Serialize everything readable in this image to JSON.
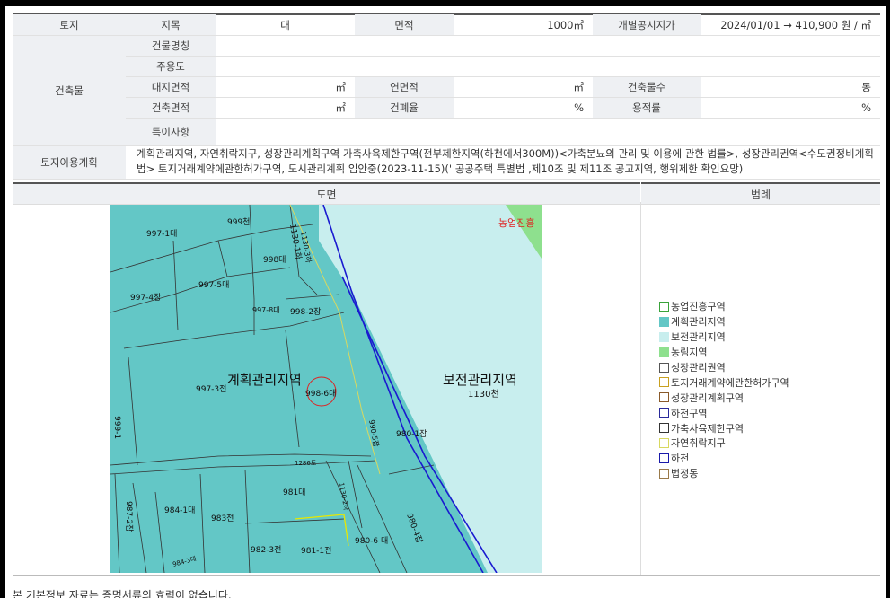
{
  "land": {
    "row_header": "토지",
    "jimok_label": "지목",
    "jimok_value": "대",
    "area_label": "면적",
    "area_value": "1000㎡",
    "price_label": "개별공시지가",
    "price_value": "2024/01/01 → 410,900 원 / ㎡"
  },
  "building": {
    "row_header": "건축물",
    "name_label": "건물명칭",
    "use_label": "주용도",
    "site_area_label": "대지면적",
    "site_area_unit": "㎡",
    "total_floor_label": "연면적",
    "total_floor_unit": "㎡",
    "count_label": "건축물수",
    "count_unit": "동",
    "building_area_label": "건축면적",
    "building_area_unit": "㎡",
    "coverage_label": "건폐율",
    "coverage_unit": "%",
    "far_label": "용적률",
    "far_unit": "%",
    "special_label": "특이사항"
  },
  "land_use": {
    "row_header": "토지이용계획",
    "text": "계획관리지역, 자연취락지구, 성장관리계획구역 가축사육제한구역(전부제한지역(하천에서300M))<가축분뇨의 관리 및 이용에 관한 법률>, 성장관리권역<수도권정비계획법> 토지거래계약에관한허가구역, 도시관리계획 입안중(2023-11-15)(' 공공주택 특별법 ,제10조 및 제11조 공고지역, 행위제한 확인요망)"
  },
  "sections": {
    "map_title": "도면",
    "legend_title": "범례"
  },
  "map_labels": {
    "zone_plan": "계획관리지역",
    "zone_conserve": "보전관리지역",
    "zone_conserve_num": "1130천",
    "zone_agri": "농업진흥",
    "parcels": [
      "999천",
      "997-1대",
      "1130-1하",
      "998대",
      "997-5대",
      "997-4장",
      "997-8대",
      "998-2장",
      "997-3전",
      "998-6대",
      "980-1잡",
      "1130천",
      "1286도",
      "981대",
      "984-1대",
      "983전",
      "987-2잡",
      "982-3전",
      "981-1전",
      "980-6 대",
      "980-4잡",
      "984-3대",
      "999-1",
      "1130-3하",
      "990-5잡",
      "1130-2하"
    ]
  },
  "legend": [
    {
      "label": "농업진흥구역",
      "fill": "#ffffff",
      "border": "#3aa33a"
    },
    {
      "label": "계획관리지역",
      "fill": "#63c7c6",
      "border": "#63c7c6"
    },
    {
      "label": "보전관리지역",
      "fill": "#c8eeee",
      "border": "#c8eeee"
    },
    {
      "label": "농림지역",
      "fill": "#8ee08e",
      "border": "#8ee08e"
    },
    {
      "label": "성장관리권역",
      "fill": "#ffffff",
      "border": "#555555"
    },
    {
      "label": "토지거래계약에관한허가구역",
      "fill": "#ffffff",
      "border": "#c8a020"
    },
    {
      "label": "성장관리계획구역",
      "fill": "#ffffff",
      "border": "#8a5a2a"
    },
    {
      "label": "하천구역",
      "fill": "#ffffff",
      "border": "#2a2a9a"
    },
    {
      "label": "가축사육제한구역",
      "fill": "#ffffff",
      "border": "#333333"
    },
    {
      "label": "자연취락지구",
      "fill": "#ffffff",
      "border": "#d8d860"
    },
    {
      "label": "하천",
      "fill": "#ffffff",
      "border": "#1a1aaa"
    },
    {
      "label": "법정동",
      "fill": "#ffffff",
      "border": "#9a7a4a"
    }
  ],
  "footnote": "본 기본정보 자료는 증명서류의 효력이 없습니다."
}
